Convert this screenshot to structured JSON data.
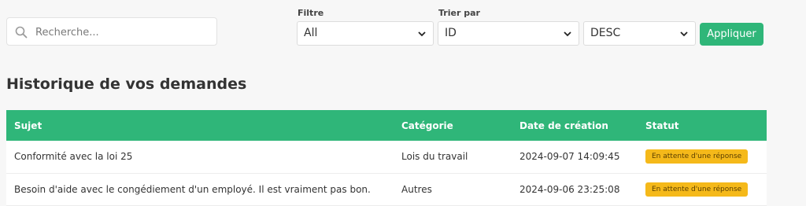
{
  "search": {
    "placeholder": "Recherche..."
  },
  "filters": {
    "filter_label": "Filtre",
    "filter_value": "All",
    "sort_label": "Trier par",
    "sort_value": "ID",
    "order_value": "DESC",
    "apply_label": "Appliquer"
  },
  "section": {
    "title": "Historique de vos demandes"
  },
  "table": {
    "headers": {
      "subject": "Sujet",
      "category": "Catégorie",
      "created": "Date de création",
      "status": "Statut"
    },
    "rows": [
      {
        "subject": "Conformité avec la loi 25",
        "category": "Lois du travail",
        "created": "2024-09-07 14:09:45",
        "status": "En attente d'une réponse"
      },
      {
        "subject": "Besoin d'aide avec le congédiement d'un employé. Il est vraiment pas bon.",
        "category": "Autres",
        "created": "2024-09-06 23:25:08",
        "status": "En attente d'une réponse"
      }
    ]
  },
  "colors": {
    "accent": "#2fb679",
    "badge": "#f5b91a"
  },
  "icons": {
    "search": "search-icon",
    "dropdown": "chevron-down-icon"
  }
}
